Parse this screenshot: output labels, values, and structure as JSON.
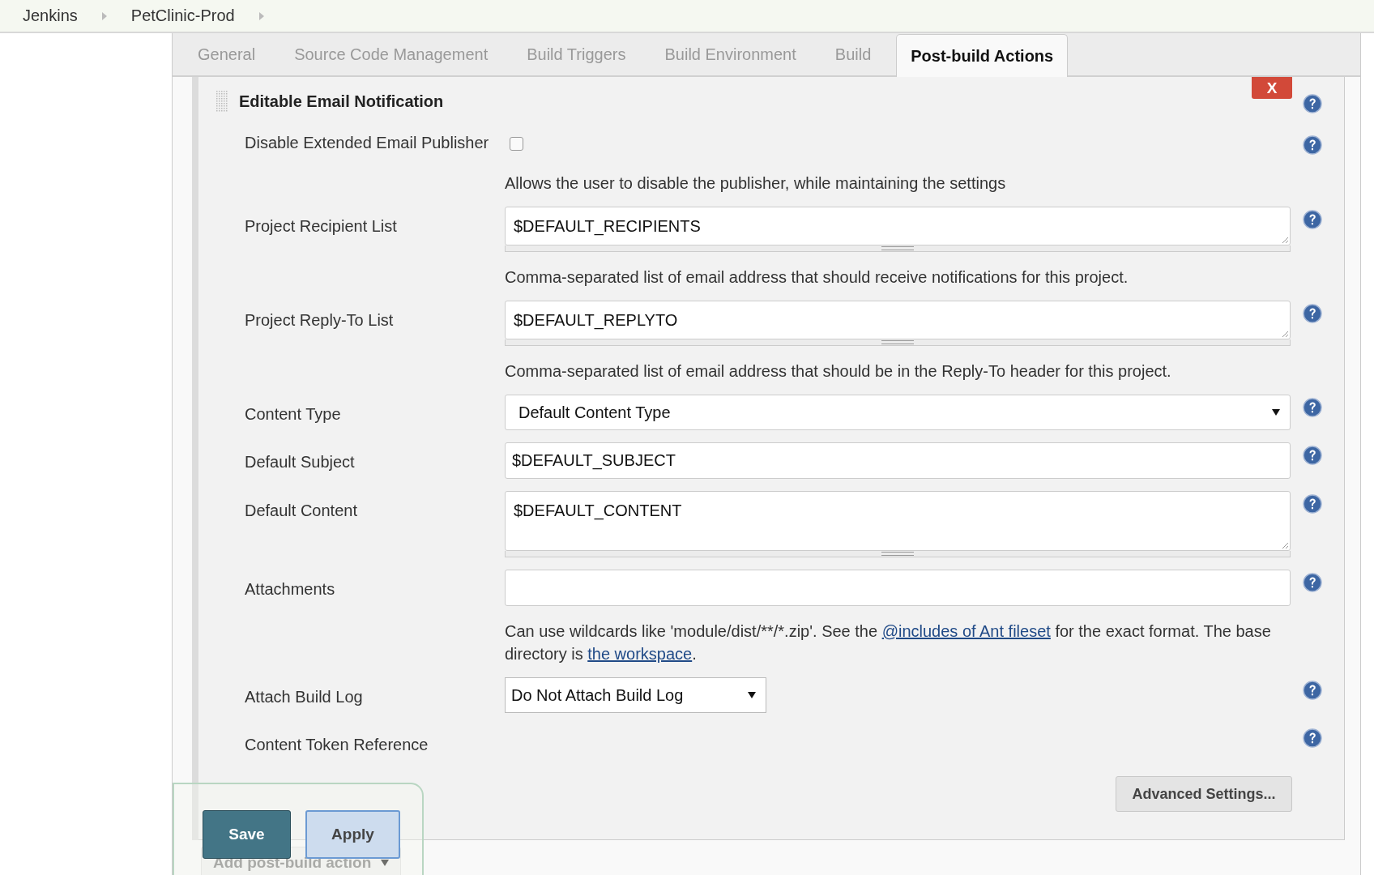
{
  "breadcrumbs": [
    {
      "label": "Jenkins"
    },
    {
      "label": "PetClinic-Prod"
    }
  ],
  "tabs": [
    {
      "label": "General",
      "selected": false
    },
    {
      "label": "Source Code Management",
      "selected": false
    },
    {
      "label": "Build Triggers",
      "selected": false
    },
    {
      "label": "Build Environment",
      "selected": false
    },
    {
      "label": "Build",
      "selected": false
    },
    {
      "label": "Post-build Actions",
      "selected": true
    }
  ],
  "section": {
    "title": "Editable Email Notification",
    "delete_button": "X",
    "rows": [
      {
        "kind": "checkbox",
        "label": "Disable Extended Email Publisher",
        "checked": false,
        "description": [
          {
            "text": "Allows the user to disable the publisher, while maintaining the settings"
          }
        ]
      },
      {
        "kind": "textarea",
        "label": "Project Recipient List",
        "value": "$DEFAULT_RECIPIENTS",
        "description": [
          {
            "text": "Comma-separated list of email address that should receive notifications for this project."
          }
        ]
      },
      {
        "kind": "textarea",
        "label": "Project Reply-To List",
        "value": "$DEFAULT_REPLYTO",
        "description": [
          {
            "text": "Comma-separated list of email address that should be in the Reply-To header for this project."
          }
        ]
      },
      {
        "kind": "select",
        "label": "Content Type",
        "value": "Default Content Type"
      },
      {
        "kind": "text",
        "label": "Default Subject",
        "value": "$DEFAULT_SUBJECT"
      },
      {
        "kind": "bigtextarea",
        "label": "Default Content",
        "value": "$DEFAULT_CONTENT"
      },
      {
        "kind": "text",
        "label": "Attachments",
        "description": [
          {
            "text": "Can use wildcards like 'module/dist/**/*.zip'. See the "
          },
          {
            "link": "@includes of Ant fileset"
          },
          {
            "text": " for the exact format. The base directory is "
          },
          {
            "link": "the workspace"
          },
          {
            "text": "."
          }
        ]
      },
      {
        "kind": "shortselect",
        "label": "Attach Build Log",
        "value": "Do Not Attach Build Log"
      },
      {
        "kind": "label",
        "label": "Content Token Reference"
      }
    ],
    "advanced_button": "Advanced Settings...",
    "add_action_button": "Add post-build action"
  },
  "save_bar": {
    "buttons": [
      {
        "label": "Save",
        "kind": "primary"
      },
      {
        "label": "Apply",
        "kind": "secondary"
      }
    ]
  }
}
